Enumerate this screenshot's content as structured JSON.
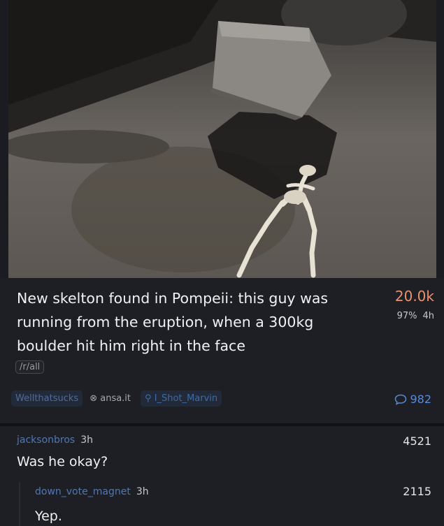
{
  "post": {
    "title": "New skelton found in Pompeii: this guy was running from the eruption, when a 300kg boulder hit him right in the face",
    "score": "20.0k",
    "upvote_ratio": "97%",
    "age": "4h",
    "tag": "/r/all",
    "subreddit": "Wellthatsucks",
    "domain": "ansa.it",
    "author": "I_Shot_Marvin",
    "comment_count": "982",
    "colors": {
      "score": "#e8926e",
      "link": "#4f77b5"
    }
  },
  "comments": [
    {
      "author": "jacksonbros",
      "time": "3h",
      "score": "4521",
      "body": "Was he okay?"
    },
    {
      "author": "down_vote_magnet",
      "time": "3h",
      "score": "2115",
      "body": "Yep."
    }
  ]
}
